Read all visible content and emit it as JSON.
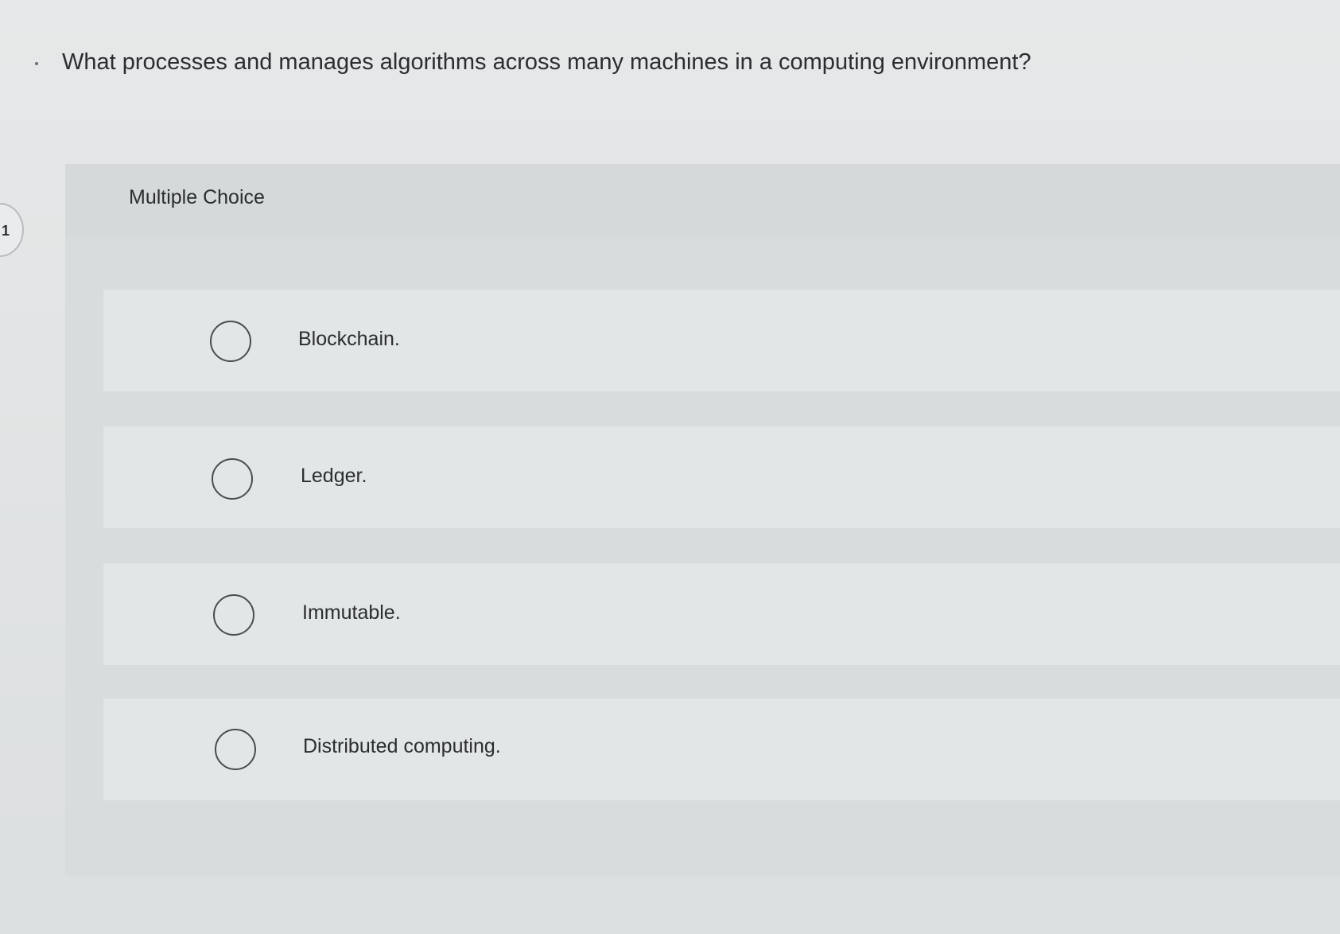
{
  "question": {
    "number": "1",
    "text": "What processes and manages algorithms across many machines in a computing environment?"
  },
  "panel": {
    "label": "Multiple Choice"
  },
  "options": [
    {
      "label": "Blockchain."
    },
    {
      "label": "Ledger."
    },
    {
      "label": "Immutable."
    },
    {
      "label": "Distributed computing."
    }
  ]
}
